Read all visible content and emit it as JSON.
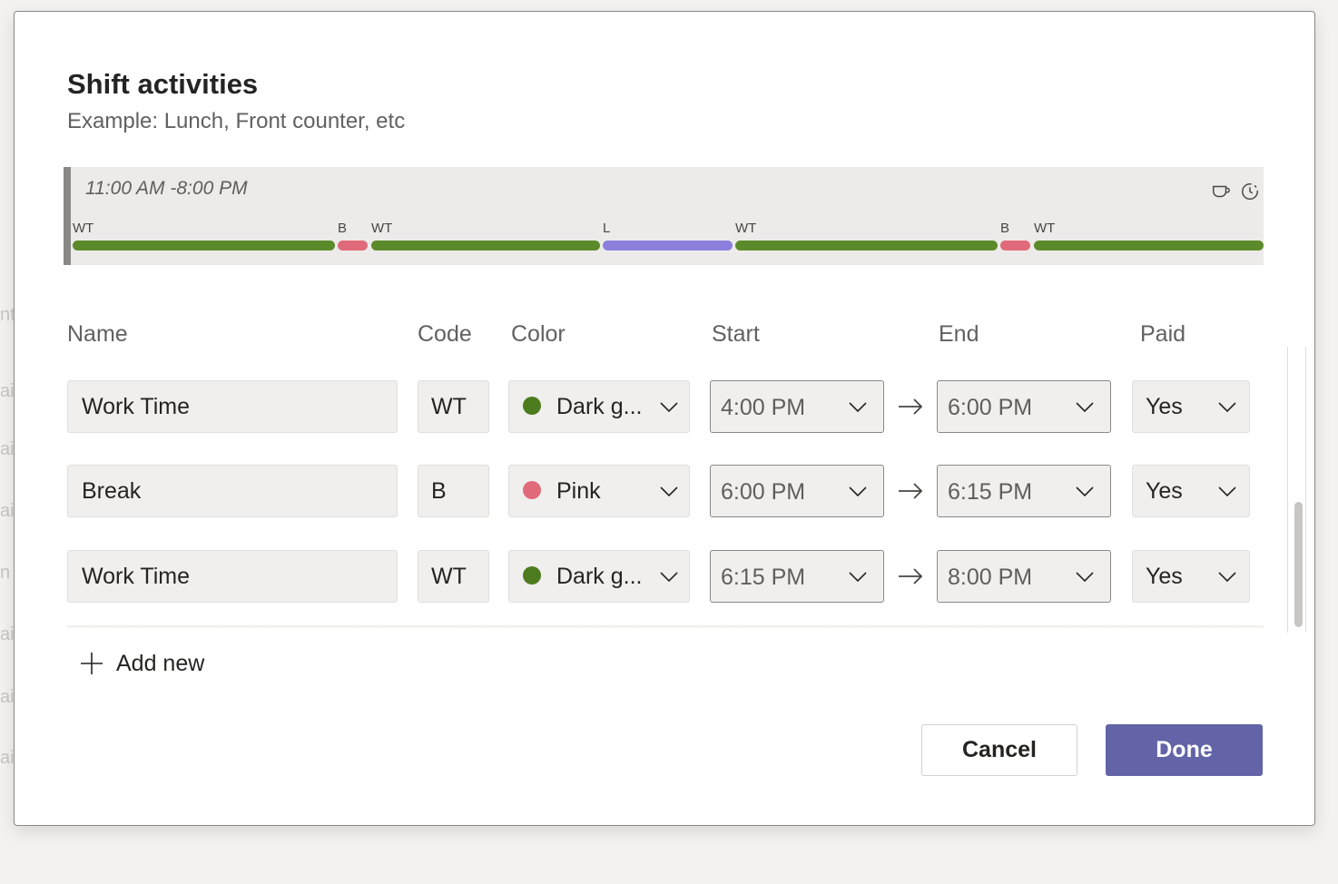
{
  "background_fragments": [
    "nt",
    "ai",
    "ai",
    "ai",
    "n",
    "ai",
    "ai",
    "ai"
  ],
  "dialog": {
    "title": "Shift activities",
    "subtitle": "Example: Lunch, Front counter, etc"
  },
  "timeline": {
    "range": "11:00 AM -8:00 PM",
    "icons": [
      "coffee-cup-icon",
      "clock-break-icon"
    ],
    "segments": [
      {
        "label": "WT",
        "color": "#5b8a2b"
      },
      {
        "label": "B",
        "color": "#e06a7a"
      },
      {
        "label": "WT",
        "color": "#5b8a2b"
      },
      {
        "label": "L",
        "color": "#8b80dc"
      },
      {
        "label": "WT",
        "color": "#5b8a2b"
      },
      {
        "label": "B",
        "color": "#e06a7a"
      },
      {
        "label": "WT",
        "color": "#5b8a2b"
      }
    ]
  },
  "columns": {
    "name": "Name",
    "code": "Code",
    "color": "Color",
    "start": "Start",
    "end": "End",
    "paid": "Paid"
  },
  "rows": [
    {
      "name": "Work Time",
      "code": "WT",
      "color_name": "Dark g...",
      "color_hex": "#4d7c1e",
      "start": "4:00 PM",
      "end": "6:00 PM",
      "paid": "Yes"
    },
    {
      "name": "Break",
      "code": "B",
      "color_name": "Pink",
      "color_hex": "#e06a7a",
      "start": "6:00 PM",
      "end": "6:15 PM",
      "paid": "Yes"
    },
    {
      "name": "Work Time",
      "code": "WT",
      "color_name": "Dark g...",
      "color_hex": "#4d7c1e",
      "start": "6:15 PM",
      "end": "8:00 PM",
      "paid": "Yes"
    }
  ],
  "actions": {
    "add_new": "Add new",
    "cancel": "Cancel",
    "done": "Done"
  },
  "colors": {
    "accent": "#6264a7",
    "work_time": "#5b8a2b",
    "break": "#e06a7a",
    "lunch": "#8b80dc"
  }
}
